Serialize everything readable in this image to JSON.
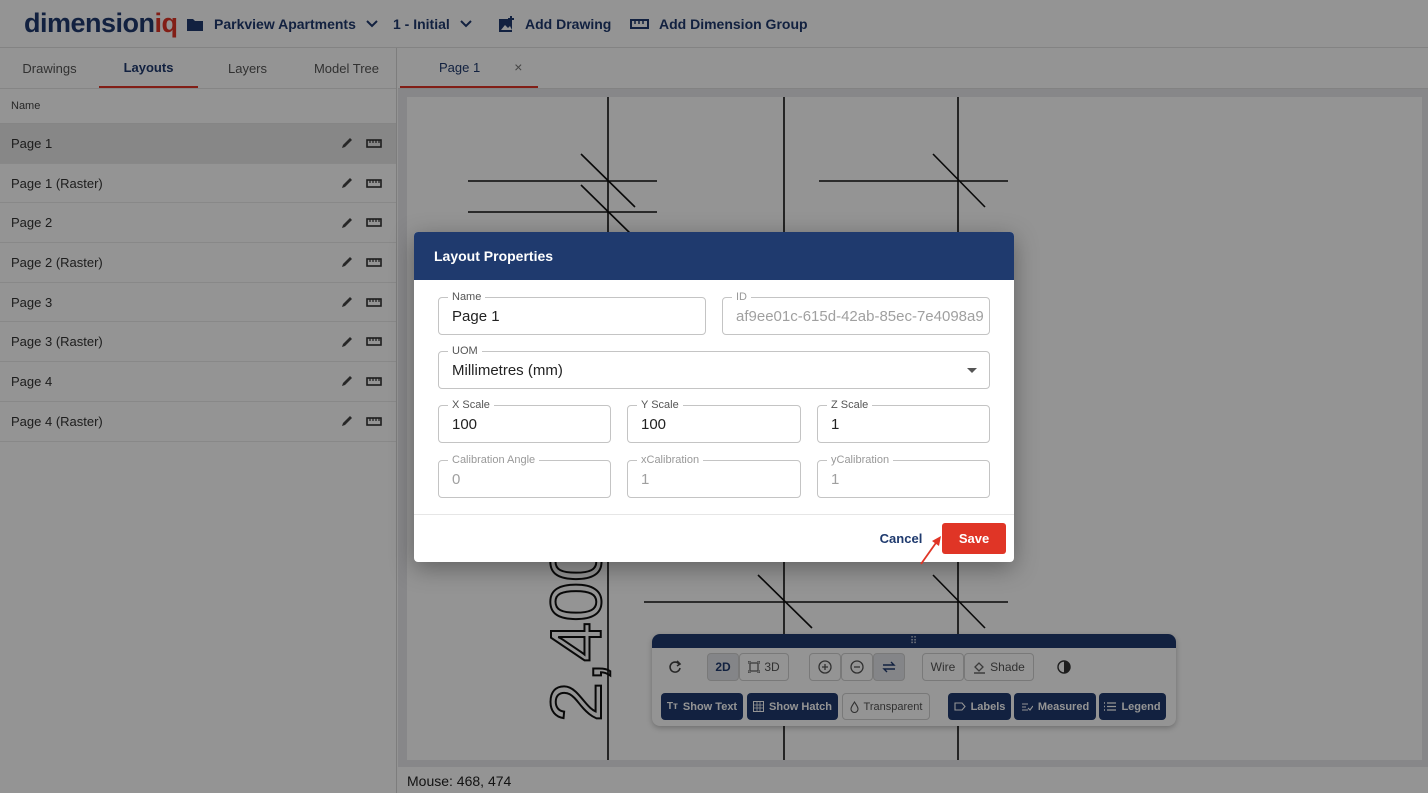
{
  "header": {
    "logo_part1": "dimension",
    "logo_part2": "iq",
    "project": "Parkview Apartments",
    "revision": "1 - Initial",
    "add_drawing": "Add Drawing",
    "add_dimension_group": "Add Dimension Group"
  },
  "sidebar": {
    "tabs": [
      "Drawings",
      "Layouts",
      "Layers",
      "Model Tree"
    ],
    "active_tab": "Layouts",
    "column_header": "Name",
    "items": [
      {
        "label": "Page 1"
      },
      {
        "label": "Page 1 (Raster)"
      },
      {
        "label": "Page 2"
      },
      {
        "label": "Page 2 (Raster)"
      },
      {
        "label": "Page 3"
      },
      {
        "label": "Page 3 (Raster)"
      },
      {
        "label": "Page 4"
      },
      {
        "label": "Page 4 (Raster)"
      }
    ]
  },
  "main": {
    "tab_label": "Page 1",
    "tab_close": "×",
    "drawing_dimension_text": "2,400",
    "status": "Mouse: 468, 474"
  },
  "view_toolbar": {
    "grip": "⠿",
    "mode_2d": "2D",
    "mode_3d": "3D",
    "wire": "Wire",
    "shade": "Shade",
    "show_text": "Show Text",
    "show_hatch": "Show Hatch",
    "transparent": "Transparent",
    "labels": "Labels",
    "measured": "Measured",
    "legend": "Legend"
  },
  "dialog": {
    "title": "Layout Properties",
    "name_label": "Name",
    "name_value": "Page 1",
    "id_label": "ID",
    "id_value": "af9ee01c-615d-42ab-85ec-7e4098a9",
    "uom_label": "UOM",
    "uom_value": "Millimetres (mm)",
    "x_scale_label": "X Scale",
    "x_scale_value": "100",
    "y_scale_label": "Y Scale",
    "y_scale_value": "100",
    "z_scale_label": "Z Scale",
    "z_scale_value": "1",
    "cal_angle_label": "Calibration Angle",
    "cal_angle_value": "0",
    "xcal_label": "xCalibration",
    "xcal_value": "1",
    "ycal_label": "yCalibration",
    "ycal_value": "1",
    "cancel": "Cancel",
    "save": "Save"
  },
  "colors": {
    "brand_navy": "#1f3a6e",
    "brand_red": "#e03526"
  }
}
